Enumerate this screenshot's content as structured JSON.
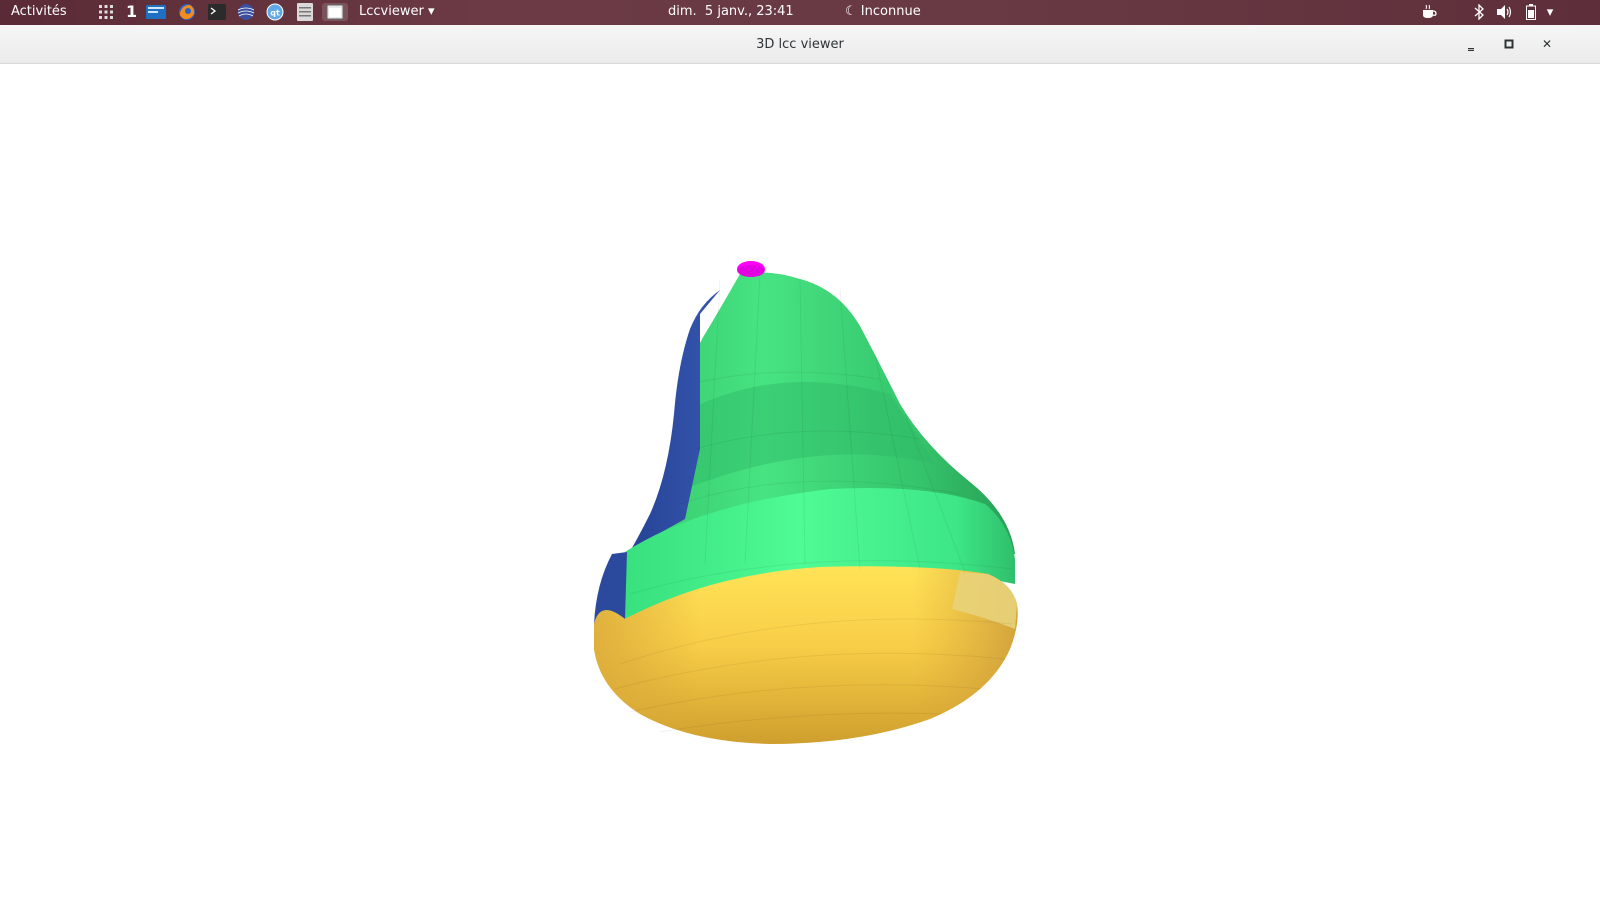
{
  "topbar": {
    "activities_label": "Activités",
    "workspace_number": "1",
    "launchers": [
      "apps-grid-icon",
      "file-manager-icon",
      "firefox-icon",
      "terminal-icon",
      "network-globe-icon",
      "qt-creator-icon",
      "text-editor-icon",
      "window-icon"
    ],
    "app_menu_label": "Lccviewer ▾",
    "clock": "dim.  5 janv., 23:41",
    "presence_status": "Inconnue",
    "tray_icons": [
      "coffee-icon",
      "bluetooth-icon",
      "volume-icon",
      "battery-icon",
      "system-menu-arrow-icon"
    ]
  },
  "window": {
    "title": "3D lcc viewer",
    "buttons": [
      "minimize",
      "maximize",
      "close"
    ]
  },
  "scene": {
    "background_color": "#ffffff",
    "object": "pear-shaped linear cell complex",
    "colors": {
      "top_cap": "#ff00ff",
      "upper_green": "#3fd97a",
      "blue_side": "#2d4fa0",
      "middle_green": "#3bf089",
      "bottom_yellow": "#f7c544"
    }
  }
}
